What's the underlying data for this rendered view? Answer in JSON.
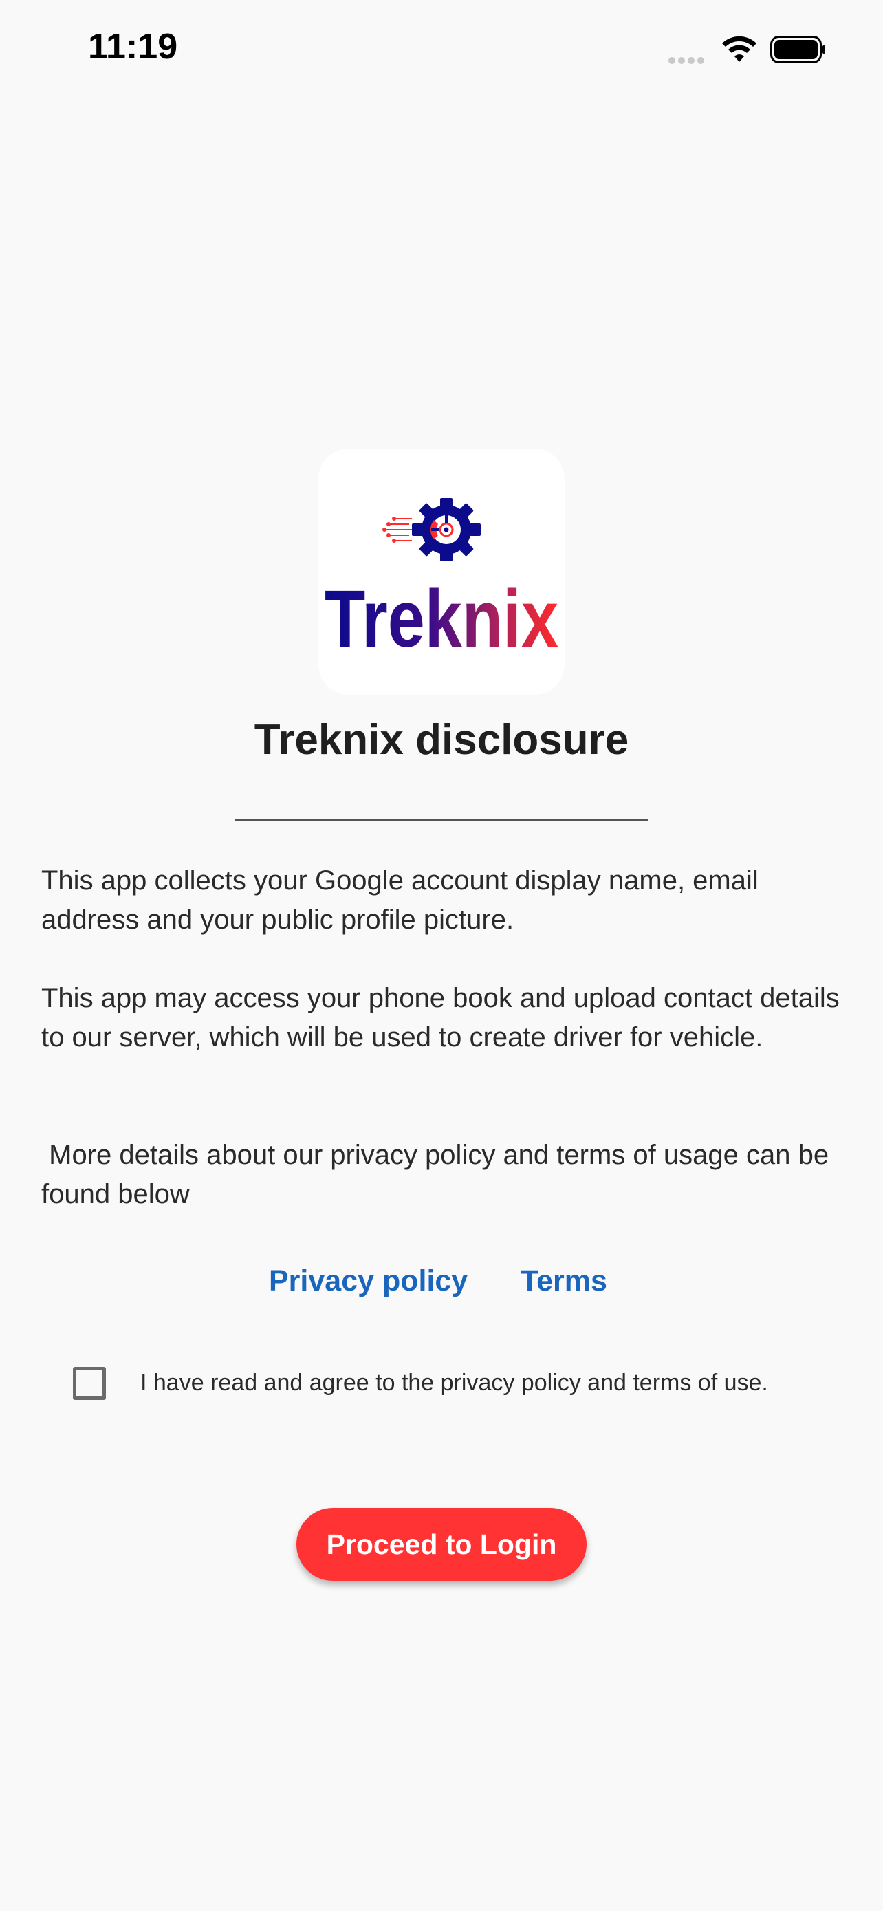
{
  "status_bar": {
    "time": "11:19"
  },
  "logo": {
    "wordmark": "Treknix",
    "colors": [
      "#0b0b8c",
      "#ff2b2b"
    ]
  },
  "disclosure": {
    "title": "Treknix disclosure",
    "paragraphs": [
      "This app collects your Google account display name, email address and your public profile picture.",
      "This app may access your phone book and upload contact details to our server, which will be used to create driver for vehicle.",
      " More details about our privacy policy and terms of usage can be found below"
    ]
  },
  "links": {
    "privacy": "Privacy policy",
    "terms": "Terms"
  },
  "agreement": {
    "label": "I have read and agree to the privacy policy and terms of use.",
    "checked": false
  },
  "actions": {
    "proceed_label": "Proceed to Login"
  },
  "theme": {
    "accent": "#ff3334",
    "link": "#1a66bd",
    "background": "#f9f9f9"
  }
}
